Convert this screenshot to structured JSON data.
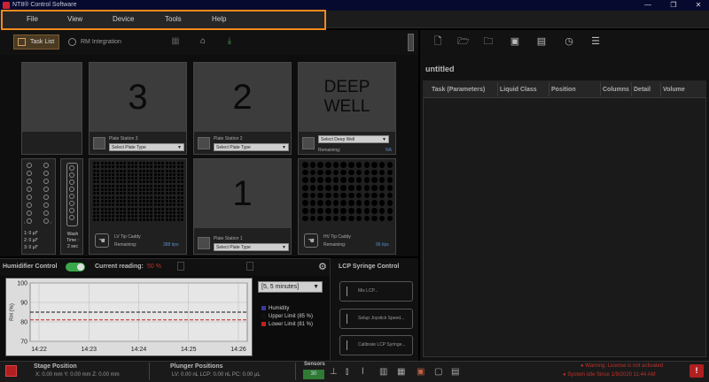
{
  "window": {
    "title": "NT8® Control Software",
    "minimize": "—",
    "maximize": "❐",
    "close": "✕"
  },
  "menu": [
    "File",
    "View",
    "Device",
    "Tools",
    "Help"
  ],
  "toolbar": {
    "tab_task_list": "Task List",
    "tab_rm": "RM Integration"
  },
  "deck": {
    "station3": {
      "number": "3",
      "label": "Plate Station 3",
      "select": "Select Plate Type"
    },
    "station2": {
      "number": "2",
      "label": "Plate Station 2",
      "select": "Select Plate Type"
    },
    "station1": {
      "number": "1",
      "label": "Plate Station 1",
      "select": "Select Plate Type"
    },
    "deepwell": {
      "line1": "DEEP",
      "line2": "WELL",
      "select": "Select Deep Well",
      "remaining_label": "Remaining:",
      "remaining_value": "NA"
    },
    "reservoir": {
      "line1": "1: 0 µl*",
      "line2": "2: 0 µl*",
      "line3": "3: 0 µl*",
      "left_mark": "L",
      "right_mark": "V"
    },
    "wash": {
      "line1": "Wash",
      "line2": "Time :",
      "line3": "2 sec"
    },
    "lv_caddy": {
      "label": "LV Tip Caddy",
      "remaining_label": "Remaining:",
      "remaining_value": "388 tips"
    },
    "hv_caddy": {
      "label": "HV Tip Caddy",
      "remaining_label": "Remaining:",
      "remaining_value": "96 tips"
    }
  },
  "humidifier": {
    "title": "Humidifier Control",
    "reading_label": "Current reading:",
    "reading_value": "50 %",
    "time_select": "[5, 5 minutes]",
    "ylabel": "RH (%)",
    "legend": [
      {
        "name": "Humidity",
        "color": "#3a3aa0"
      },
      {
        "name": "Upper Limit (85 %)",
        "color": "#111111"
      },
      {
        "name": "Lower Limit (81 %)",
        "color": "#c02020"
      }
    ]
  },
  "chart_data": {
    "type": "line",
    "ylabel": "RH (%)",
    "ylim": [
      70,
      100
    ],
    "yticks": [
      70,
      80,
      90,
      100
    ],
    "xticks": [
      "14:22",
      "14:23",
      "14:24",
      "14:25",
      "14:26"
    ],
    "series": [
      {
        "name": "Upper Limit (85 %)",
        "values": [
          85,
          85,
          85,
          85,
          85
        ],
        "color": "#111111",
        "dash": true
      },
      {
        "name": "Lower Limit (81 %)",
        "values": [
          81,
          81,
          81,
          81,
          81
        ],
        "color": "#c02020",
        "dash": true
      }
    ],
    "grid": true,
    "legend": "right"
  },
  "lcp": {
    "title": "LCP Syringe Control",
    "mix": "Mix LCP...",
    "joystick": "Setup Joystick Speed...",
    "calibrate": "Calibrate LCP Syringe..."
  },
  "right_panel": {
    "title": "untitled",
    "columns": [
      "Task (Parameters)",
      "Liquid Class",
      "Position",
      "Columns",
      "Detail",
      "Volume"
    ]
  },
  "status": {
    "stage_title": "Stage Position",
    "stage_values": "X: 0.00 mm   Y: 0.00 mm   Z: 0.00 mm",
    "plunger_title": "Plunger Positions",
    "plunger_values": "LV: 0.00 nL   LCP: 0.00 nL   PC: 0.00 µL",
    "sensors_title": "Sensors",
    "sensor_value": "30",
    "warn1": "Warning: License is not activated",
    "warn2": "System idle Since 1/9/2020 11:44 AM"
  },
  "colors": {
    "accent": "#f08a1c",
    "warning": "#c0302a",
    "toggle": "#3aa84a"
  }
}
